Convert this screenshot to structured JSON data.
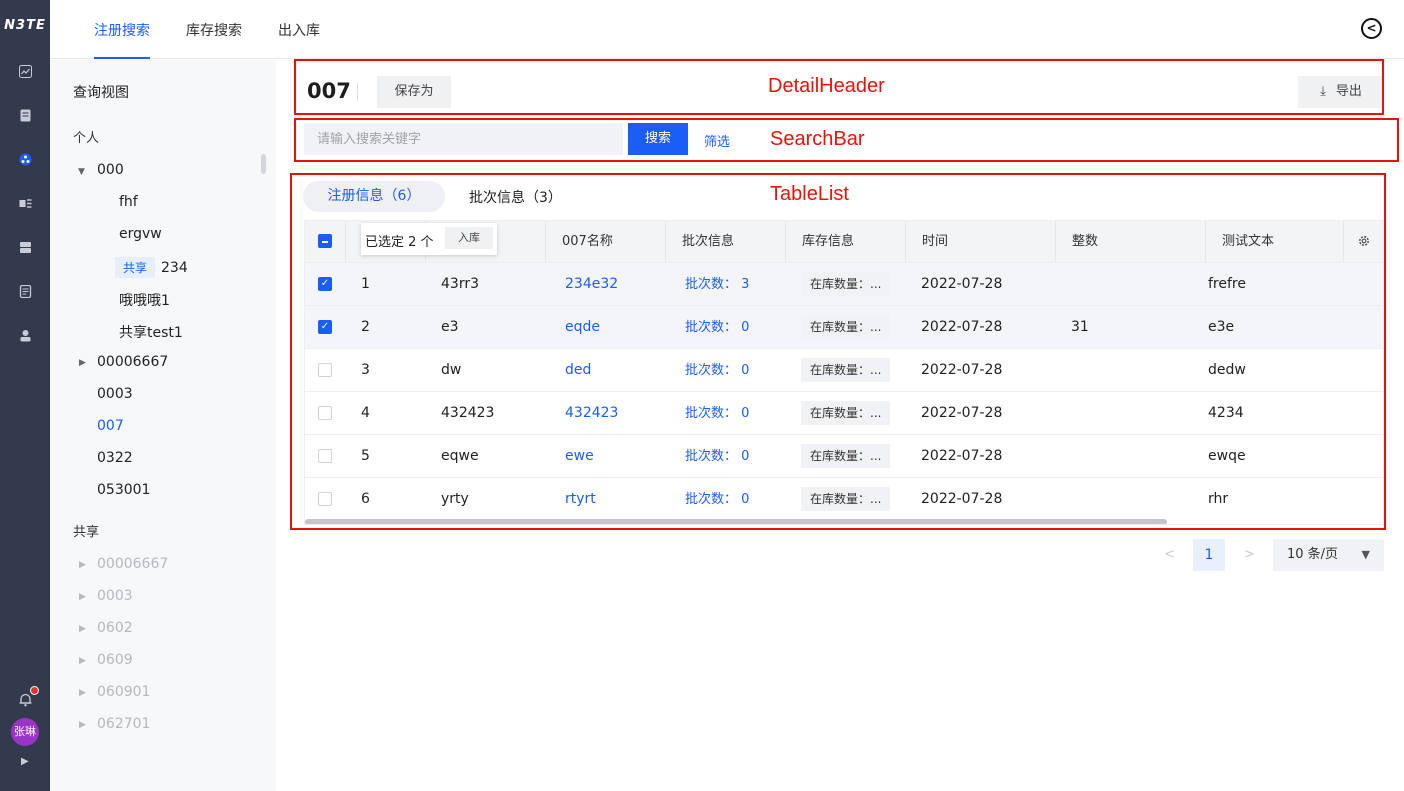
{
  "rail": {
    "logo": "N3TE",
    "avatar_text": "张琳",
    "icons": [
      "chart-icon",
      "document-icon",
      "cluster-icon",
      "flow-icon",
      "database-icon",
      "report-icon",
      "user-icon"
    ]
  },
  "top_tabs": [
    "注册搜索",
    "库存搜索",
    "出入库"
  ],
  "sidebar": {
    "header": "查询视图",
    "personal_label": "个人",
    "shared_label": "共享",
    "personal": [
      {
        "label": "000",
        "expanded": true
      },
      {
        "label": "fhf"
      },
      {
        "label": "ergvw"
      },
      {
        "tag": "共享",
        "label": "234"
      },
      {
        "label": "哦哦哦1"
      },
      {
        "label": "共享test1"
      },
      {
        "label": "00006667",
        "collapsed": true
      },
      {
        "label": "0003"
      },
      {
        "label": "007",
        "selected": true
      },
      {
        "label": "0322"
      },
      {
        "label": "053001"
      }
    ],
    "shared": [
      "00006667",
      "0003",
      "0602",
      "0609",
      "060901",
      "062701"
    ]
  },
  "detail_header": {
    "title": "007",
    "save_as": "保存为",
    "export": "导出"
  },
  "search": {
    "placeholder": "请输入搜索关键字",
    "button": "搜索",
    "filter": "筛选"
  },
  "annotations": {
    "detail_header": "DetailHeader",
    "search_bar": "SearchBar",
    "table_list": "TableList"
  },
  "list_tabs": [
    "注册信息（6）",
    "批次信息（3）"
  ],
  "table": {
    "selection_text": "已选定 2 个",
    "selection_action": "入库",
    "columns": [
      "007名称",
      "批次信息",
      "库存信息",
      "时间",
      "整数",
      "测试文本"
    ],
    "rows": [
      {
        "checked": true,
        "no": "1",
        "id": "43rr3",
        "name": "234e32",
        "batch": "批次数：  3",
        "stock": "在库数量：...",
        "time": "2022-07-28",
        "int": "",
        "text": "frefre"
      },
      {
        "checked": true,
        "no": "2",
        "id": "e3",
        "name": "eqde",
        "batch": "批次数：  0",
        "stock": "在库数量：...",
        "time": "2022-07-28",
        "int": "31",
        "text": "e3e"
      },
      {
        "checked": false,
        "no": "3",
        "id": "dw",
        "name": "ded",
        "batch": "批次数：  0",
        "stock": "在库数量：...",
        "time": "2022-07-28",
        "int": "",
        "text": "dedw"
      },
      {
        "checked": false,
        "no": "4",
        "id": "432423",
        "name": "432423",
        "batch": "批次数：  0",
        "stock": "在库数量：...",
        "time": "2022-07-28",
        "int": "",
        "text": "4234"
      },
      {
        "checked": false,
        "no": "5",
        "id": "eqwe",
        "name": "ewe",
        "batch": "批次数：  0",
        "stock": "在库数量：...",
        "time": "2022-07-28",
        "int": "",
        "text": "ewqe"
      },
      {
        "checked": false,
        "no": "6",
        "id": "yrty",
        "name": "rtyrt",
        "batch": "批次数：  0",
        "stock": "在库数量：...",
        "time": "2022-07-28",
        "int": "",
        "text": "rhr"
      }
    ]
  },
  "pagination": {
    "current": "1",
    "page_size": "10 条/页"
  },
  "colors": {
    "accent": "#1b5ef5",
    "rail": "#343a4e",
    "annotation": "#e5140a"
  }
}
